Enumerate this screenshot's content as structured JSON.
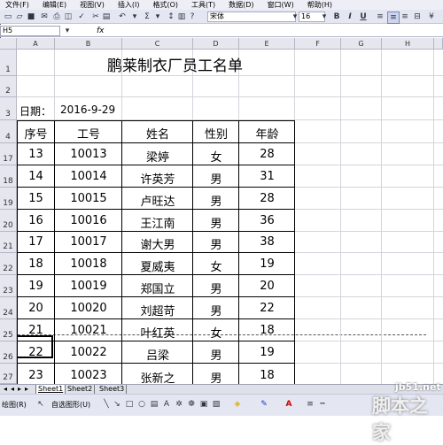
{
  "menu": [
    "文件(F)",
    "编辑(E)",
    "视图(V)",
    "插入(I)",
    "格式(O)",
    "工具(T)",
    "数据(D)",
    "窗口(W)",
    "帮助(H)"
  ],
  "toolbar": {
    "font_name": "宋体",
    "font_size": "16",
    "bold": "B",
    "italic": "I",
    "underline": "U",
    "sigma": "Σ"
  },
  "formula_bar": {
    "name_box": "H5",
    "fx_label": "fx",
    "content": ""
  },
  "columns": [
    "A",
    "B",
    "C",
    "D",
    "E",
    "F",
    "G",
    "H"
  ],
  "rows": [
    "1",
    "2",
    "3",
    "4",
    "17",
    "18",
    "19",
    "20",
    "21",
    "22",
    "23",
    "24",
    "25",
    "26",
    "27"
  ],
  "sheet": {
    "title": "鹏莱制衣厂员工名单",
    "date_label": "日期：",
    "date_value": "2016-9-29",
    "headers": [
      "序号",
      "工号",
      "姓名",
      "性别",
      "年龄"
    ],
    "records": [
      [
        "13",
        "10013",
        "梁婷",
        "女",
        "28"
      ],
      [
        "14",
        "10014",
        "许英芳",
        "男",
        "31"
      ],
      [
        "15",
        "10015",
        "卢旺达",
        "男",
        "28"
      ],
      [
        "16",
        "10016",
        "王江南",
        "男",
        "36"
      ],
      [
        "17",
        "10017",
        "谢大男",
        "男",
        "38"
      ],
      [
        "18",
        "10018",
        "夏威夷",
        "女",
        "19"
      ],
      [
        "19",
        "10019",
        "郑国立",
        "男",
        "20"
      ],
      [
        "20",
        "10020",
        "刘超苛",
        "男",
        "22"
      ],
      [
        "21",
        "10021",
        "叶红英",
        "女",
        "18"
      ],
      [
        "22",
        "10022",
        "吕梁",
        "男",
        "19"
      ],
      [
        "23",
        "10023",
        "张新之",
        "男",
        "18"
      ]
    ]
  },
  "sheet_tabs": [
    "Sheet1",
    "Sheet2",
    "Sheet3"
  ],
  "draw_toolbar": {
    "draw_label": "绘图(R)",
    "autoshape_label": "自选图形(U)"
  },
  "watermark": {
    "domain": "jb51.net",
    "brand": "脚本之家"
  }
}
